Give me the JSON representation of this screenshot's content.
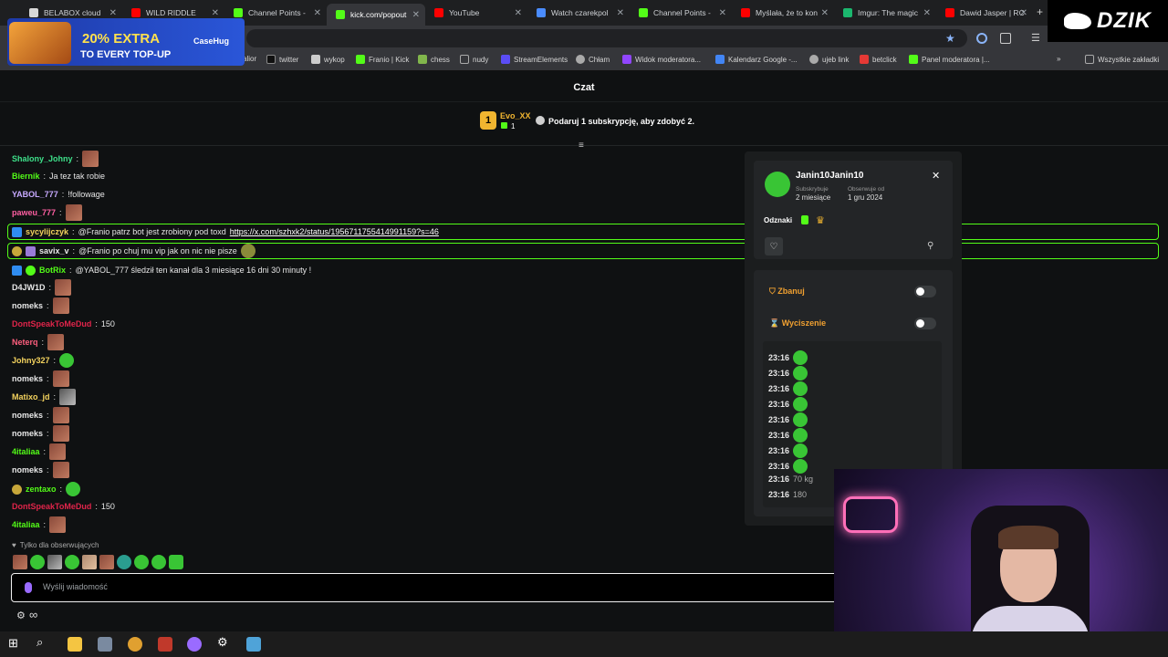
{
  "browser": {
    "tabs": [
      {
        "label": "BELABOX cloud",
        "color": "#d8d8d8"
      },
      {
        "label": "WILD RIDDLE",
        "color": "#ff0000"
      },
      {
        "label": "Channel Points -",
        "color": "#53fc18"
      },
      {
        "label": "kick.com/popout",
        "color": "#53fc18"
      },
      {
        "label": "YouTube",
        "color": "#ff0000"
      },
      {
        "label": "Watch czarekpol",
        "color": "#4a8cff"
      },
      {
        "label": "Channel Points -",
        "color": "#53fc18"
      },
      {
        "label": "Myślała, że to kon",
        "color": "#ff0000"
      },
      {
        "label": "Imgur: The magic",
        "color": "#1bb76e"
      },
      {
        "label": "Dawid Jasper | RC",
        "color": "#ff0000"
      }
    ],
    "new_tab": "+",
    "bookmarks": [
      {
        "label": "alior",
        "color": "#c62828"
      },
      {
        "label": "twitter",
        "color": "#111111"
      },
      {
        "label": "wykop",
        "color": "#cccccc"
      },
      {
        "label": "Franio | Kick",
        "color": "#53fc18"
      },
      {
        "label": "chess",
        "color": "#81b64c"
      },
      {
        "label": "nudy",
        "color": "#888888"
      },
      {
        "label": "StreamElements",
        "color": "#5b4df5"
      },
      {
        "label": "Chłam",
        "color": "#aaaaaa"
      },
      {
        "label": "Widok moderatora...",
        "color": "#9146ff"
      },
      {
        "label": "Kalendarz Google -...",
        "color": "#4285f4"
      },
      {
        "label": "ujeb link",
        "color": "#aaaaaa"
      },
      {
        "label": "betclick",
        "color": "#e53935"
      },
      {
        "label": "Panel moderatora |...",
        "color": "#53fc18"
      }
    ],
    "all_bookmarks": "Wszystkie zakładki"
  },
  "ad": {
    "headline": "20% EXTRA",
    "subline": "TO EVERY TOP-UP",
    "brand": "CaseHug"
  },
  "logo_text": "DZIK",
  "chat": {
    "title": "Czat",
    "leader": {
      "rank": "1",
      "name": "Evo_XX",
      "count": "1"
    },
    "gift_prompt": "Podaruj 1 subskrypcję, aby zdobyć 2.",
    "messages": [
      {
        "user": "Shalony_Johny",
        "color": "#3ee08a",
        "text": "",
        "emote": "brown"
      },
      {
        "user": "Biernik",
        "color": "#53fc18",
        "text": "Ja tez tak robie",
        "emote": ""
      },
      {
        "user": "YABOL_777",
        "color": "#c7a9ff",
        "text": "!followage",
        "emote": ""
      },
      {
        "user": "paweu_777",
        "color": "#ff5fa2",
        "text": "",
        "emote": "brown"
      },
      {
        "user": "sycylijczyk",
        "color": "#f4d35e",
        "text": "@Franio patrz bot jest zrobiony pod toxd",
        "link": "https://x.com/szhxk2/status/1956711755414991159?s=46",
        "pinned": true
      },
      {
        "user": "savix_v",
        "color": "#e8e8e8",
        "text": "@Franio po chuj mu vip jak on nic nie pisze",
        "emote": "green",
        "pinned": true
      },
      {
        "user": "BotRix",
        "color": "#53fc18",
        "text": "@YABOL_777 śledził ten kanał dla 3 miesiące 16 dni 30 minuty !",
        "emote": ""
      },
      {
        "user": "D4JW1D",
        "color": "#e8e8e8",
        "text": "",
        "emote": "brown"
      },
      {
        "user": "nomeks",
        "color": "#e8e8e8",
        "text": "",
        "emote": "brown"
      },
      {
        "user": "DontSpeakToMeDud",
        "color": "#e0244a",
        "text": "150",
        "emote": ""
      },
      {
        "user": "Neterq",
        "color": "#ff5f7e",
        "text": "",
        "emote": "brown"
      },
      {
        "user": "Johny327",
        "color": "#f4d35e",
        "text": "",
        "emote": "green"
      },
      {
        "user": "nomeks",
        "color": "#e8e8e8",
        "text": "",
        "emote": "brown"
      },
      {
        "user": "Matixo_jd",
        "color": "#f4d35e",
        "text": "",
        "emote": "brown"
      },
      {
        "user": "nomeks",
        "color": "#e8e8e8",
        "text": "",
        "emote": "brown"
      },
      {
        "user": "nomeks",
        "color": "#e8e8e8",
        "text": "",
        "emote": "brown"
      },
      {
        "user": "4italiaa",
        "color": "#53fc18",
        "text": "",
        "emote": "brown"
      },
      {
        "user": "nomeks",
        "color": "#e8e8e8",
        "text": "",
        "emote": "brown"
      },
      {
        "user": "zentaxo",
        "color": "#53fc18",
        "text": "",
        "emote": "green"
      },
      {
        "user": "DontSpeakToMeDud",
        "color": "#e0244a",
        "text": "150",
        "emote": ""
      },
      {
        "user": "4italiaa",
        "color": "#53fc18",
        "text": "",
        "emote": "brown"
      }
    ],
    "followers_only": "Tylko dla obserwujących",
    "input_placeholder": "Wyślij wiadomość"
  },
  "usercard": {
    "name": "Janin10Janin10",
    "sub_label": "Subskrybuje",
    "sub_value": "2 miesiące",
    "follow_label": "Obserwuje od",
    "follow_value": "1 gru 2024",
    "badges_label": "Odznaki",
    "ban_label": "Zbanuj",
    "timeout_label": "Wyciszenie",
    "log": [
      {
        "time": "23:16",
        "value": ""
      },
      {
        "time": "23:16",
        "value": ""
      },
      {
        "time": "23:16",
        "value": ""
      },
      {
        "time": "23:16",
        "value": ""
      },
      {
        "time": "23:16",
        "value": ""
      },
      {
        "time": "23:16",
        "value": ""
      },
      {
        "time": "23:16",
        "value": ""
      },
      {
        "time": "23:16",
        "value": ""
      },
      {
        "time": "23:16",
        "value": "70 kg"
      },
      {
        "time": "23:16",
        "value": "180"
      }
    ]
  },
  "colors": {
    "kick_green": "#53fc18",
    "ban_orange": "#f0a030",
    "gold": "#f1b530"
  }
}
